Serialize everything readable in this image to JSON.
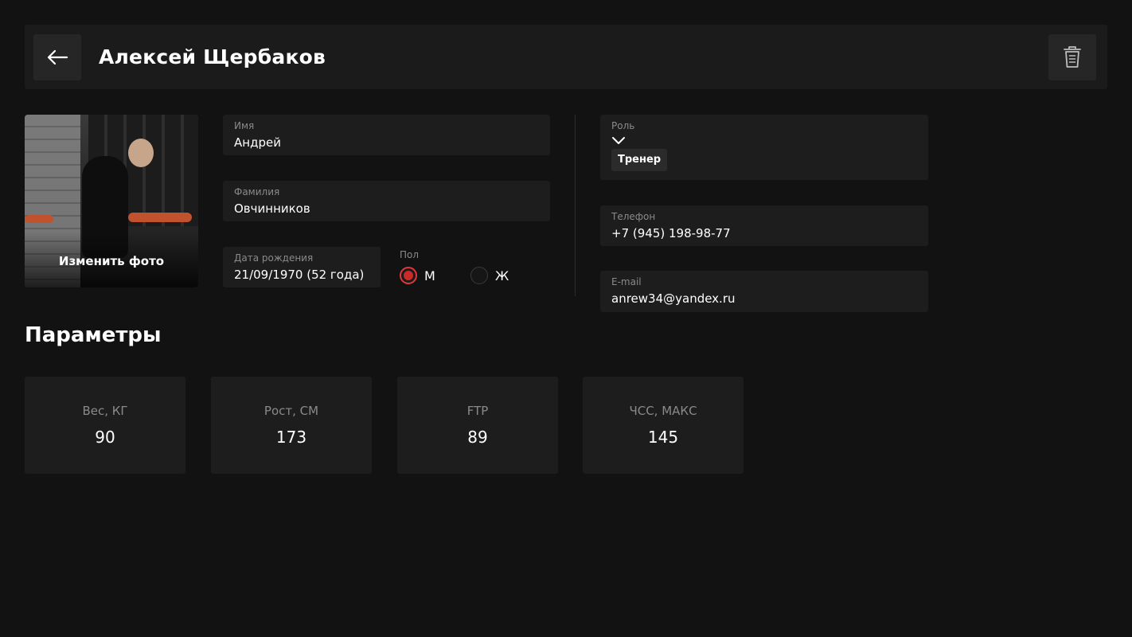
{
  "header": {
    "title": "Алексей Щербаков",
    "back_icon": "arrow-left-icon",
    "delete_icon": "trash-icon"
  },
  "photo": {
    "change_label": "Изменить фото"
  },
  "form": {
    "first_name": {
      "label": "Имя",
      "value": "Андрей"
    },
    "last_name": {
      "label": "Фамилия",
      "value": "Овчинников"
    },
    "birth_date": {
      "label": "Дата рождения",
      "value": "21/09/1970 (52 года)"
    },
    "gender": {
      "label": "Пол",
      "options": [
        {
          "label": "М",
          "selected": true
        },
        {
          "label": "Ж",
          "selected": false
        }
      ]
    },
    "role": {
      "label": "Роль",
      "chip": "Тренер",
      "chevron_icon": "chevron-down-icon"
    },
    "phone": {
      "label": "Телефон",
      "value": "+7 (945) 198-98-77"
    },
    "email": {
      "label": "E-mail",
      "value": "anrew34@yandex.ru"
    }
  },
  "parameters": {
    "title": "Параметры",
    "items": [
      {
        "label": "Вес, КГ",
        "value": "90"
      },
      {
        "label": "Рост, СМ",
        "value": "173"
      },
      {
        "label": "FTP",
        "value": "89"
      },
      {
        "label": "ЧСС, МАКС",
        "value": "145"
      }
    ]
  },
  "colors": {
    "background": "#121212",
    "panel": "#1d1d1d",
    "accent": "#c92a2a",
    "label": "#8a8a8a"
  }
}
